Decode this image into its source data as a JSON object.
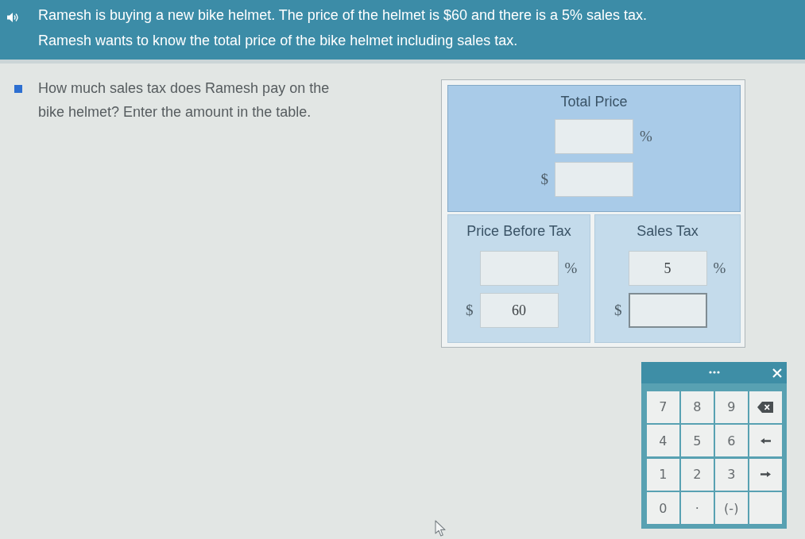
{
  "prompt": {
    "sentences": [
      "Ramesh is buying a new bike helmet. The price of the helmet is $60 and there is a 5% sales tax.",
      "Ramesh wants to know the total price of the bike helmet including sales tax."
    ]
  },
  "question": {
    "text": "How much sales tax does Ramesh pay on the bike helmet? Enter the amount in the table."
  },
  "table": {
    "total": {
      "heading": "Total Price",
      "fields": [
        {
          "kind": "percent",
          "unit": "%",
          "focused": false
        },
        {
          "kind": "dollar",
          "unit": "$",
          "focused": false
        }
      ]
    },
    "parts": [
      {
        "heading": "Price Before Tax",
        "fields": [
          {
            "kind": "percent",
            "unit": "%",
            "focused": false
          },
          {
            "kind": "dollar",
            "unit": "$",
            "value": "60",
            "focused": false
          }
        ]
      },
      {
        "heading": "Sales Tax",
        "fields": [
          {
            "kind": "percent",
            "unit": "%",
            "value": "5",
            "focused": false
          },
          {
            "kind": "dollar",
            "unit": "$",
            "focused": true
          }
        ]
      }
    ]
  },
  "keypad": {
    "keys": [
      {
        "kind": "text",
        "label": "7"
      },
      {
        "kind": "text",
        "label": "8"
      },
      {
        "kind": "text",
        "label": "9"
      },
      {
        "kind": "backspace"
      },
      {
        "kind": "text",
        "label": "4"
      },
      {
        "kind": "text",
        "label": "5"
      },
      {
        "kind": "text",
        "label": "6"
      },
      {
        "kind": "left"
      },
      {
        "kind": "text",
        "label": "1"
      },
      {
        "kind": "text",
        "label": "2"
      },
      {
        "kind": "text",
        "label": "3"
      },
      {
        "kind": "right"
      },
      {
        "kind": "text",
        "label": "0"
      },
      {
        "kind": "point",
        "label": "."
      },
      {
        "kind": "text",
        "label": "(-)"
      },
      {
        "kind": "blank"
      }
    ]
  }
}
